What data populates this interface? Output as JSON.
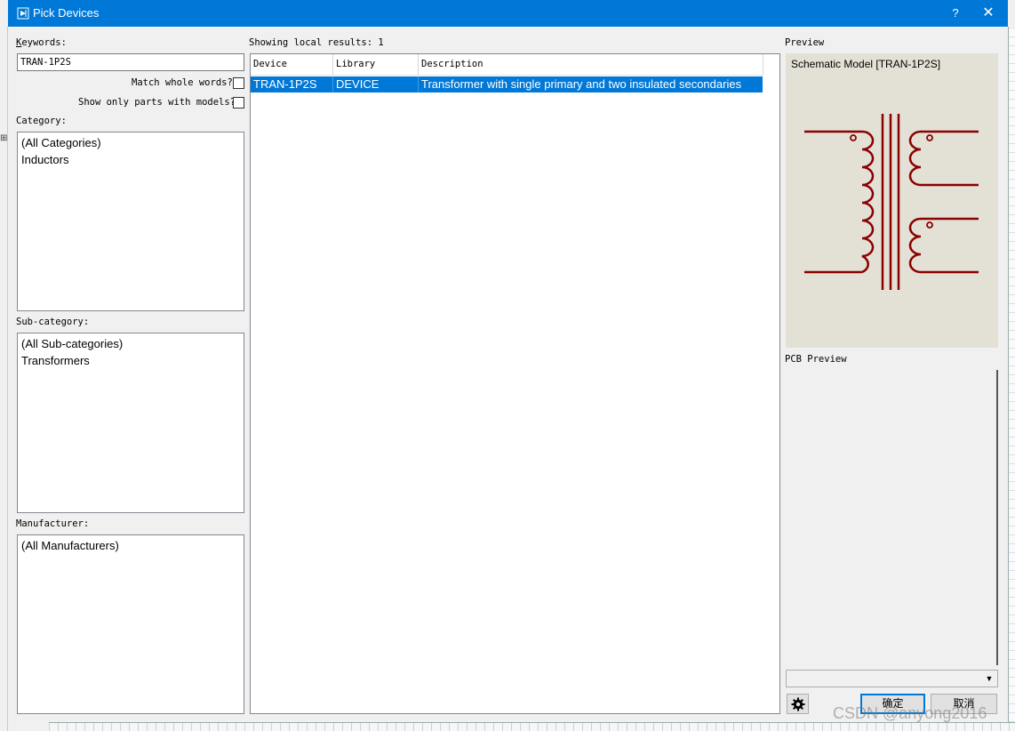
{
  "window": {
    "title": "Pick Devices",
    "help_label": "?",
    "close_label": "✕"
  },
  "left": {
    "keywords_label": "Keywords:",
    "keywords_value": "TRAN-1P2S",
    "match_whole_words_label": "Match whole words?",
    "match_whole_words_checked": false,
    "show_only_models_label": "Show only parts with models?",
    "show_only_models_checked": false,
    "category_label": "Category:",
    "categories": [
      "(All Categories)",
      "Inductors"
    ],
    "subcategory_label": "Sub-category:",
    "subcategories": [
      "(All Sub-categories)",
      "Transformers"
    ],
    "manufacturer_label": "Manufacturer:",
    "manufacturers": [
      "(All Manufacturers)"
    ]
  },
  "results": {
    "status": "Showing local results: 1",
    "columns": [
      "Device",
      "Library",
      "Description"
    ],
    "rows": [
      {
        "device": "TRAN-1P2S",
        "library": "DEVICE",
        "description": "Transformer with single primary and two insulated secondaries",
        "selected": true
      }
    ]
  },
  "preview": {
    "label": "Preview",
    "caption": "Schematic Model [TRAN-1P2S]",
    "symbol_color": "#8b0000",
    "background_color": "#e3e1d6",
    "pcb_label": "PCB Preview"
  },
  "footer": {
    "combo_value": "",
    "settings_icon": "gear-icon",
    "ok_label": "确定",
    "cancel_label": "取消"
  },
  "watermark": "CSDN @anyong2016"
}
